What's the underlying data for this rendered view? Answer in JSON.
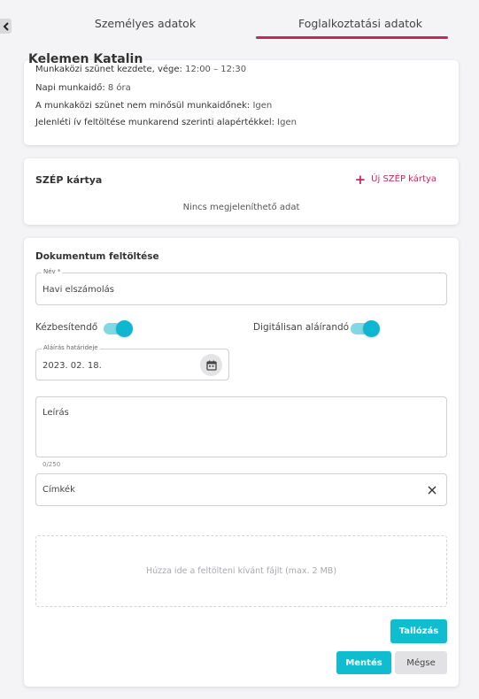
{
  "tabs": [
    {
      "label": "Személyes adatok",
      "active": false
    },
    {
      "label": "Foglalkoztatási adatok",
      "active": true
    }
  ],
  "person": {
    "name": "Kelemen Katalin"
  },
  "info": [
    {
      "label": "Munkaközi szünet kezdete, vége:",
      "value": "12:00 – 12:30"
    },
    {
      "label": "Napi munkaidő:",
      "value": "8 óra"
    },
    {
      "label": "A munkaközi szünet nem minősül munkaidőnek:",
      "value": "Igen"
    },
    {
      "label": "Jelenléti ív feltöltése munkarend szerinti alapértékkel:",
      "value": "Igen"
    }
  ],
  "szep": {
    "title": "SZÉP kártya",
    "add_label": "Új SZÉP kártya",
    "empty_text": "Nincs megjeleníthető adat"
  },
  "document": {
    "title": "Dokumentum feltöltése",
    "name_label": "Név *",
    "name_value": "Havi elszámolás",
    "deliverable_label": "Kézbesítendő",
    "deliverable_on": true,
    "digital_sign_label": "Digitálisan aláírandó",
    "digital_sign_on": true,
    "deadline_label": "Aláírás határideje",
    "deadline_value": "2023. 02. 18.",
    "description_placeholder": "Leírás",
    "char_count": "0/250",
    "tags_placeholder": "Címkék",
    "dropzone_text": "Húzza ide a feltölteni kívánt fájlt (max. 2 MB)",
    "browse_label": "Tallózás",
    "save_label": "Mentés",
    "cancel_label": "Mégse"
  },
  "colors": {
    "accent": "#0fbcd0",
    "brand": "#c8275b"
  },
  "icons": {
    "back": "chevron-left-icon",
    "add": "plus-icon",
    "calendar": "calendar-icon",
    "clear": "close-icon"
  }
}
